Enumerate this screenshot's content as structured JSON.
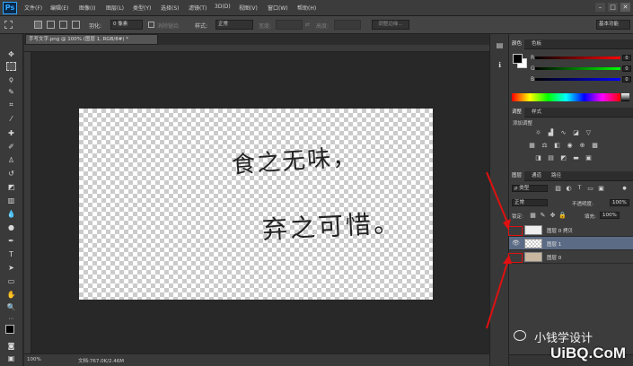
{
  "app": {
    "logo": "Ps"
  },
  "menu": [
    "文件(F)",
    "编辑(E)",
    "图像(I)",
    "图层(L)",
    "类型(Y)",
    "选择(S)",
    "滤镜(T)",
    "3D(D)",
    "视图(V)",
    "窗口(W)",
    "帮助(H)"
  ],
  "window_controls": {
    "minimize": "–",
    "maximize": "□",
    "close": "✕"
  },
  "options": {
    "feather_label": "羽化:",
    "feather_value": "0 像素",
    "antialias_label": "消除锯齿",
    "style_label": "样式:",
    "style_value": "正常",
    "width_label": "宽度:",
    "height_label": "高度:",
    "refine_label": "调整边缘...",
    "workspace": "基本功能"
  },
  "document": {
    "tab_title": "手写文字.png @ 100% (图层 1, RGB/8#) *",
    "zoom": "100%",
    "doc_info": "文档:767.0K/2.46M"
  },
  "color_panel": {
    "tabs": [
      "颜色",
      "色板"
    ],
    "channels": [
      {
        "label": "R",
        "value": "0"
      },
      {
        "label": "G",
        "value": "0"
      },
      {
        "label": "B",
        "value": "0"
      }
    ]
  },
  "adjustments_panel": {
    "tabs": [
      "调整",
      "样式"
    ],
    "title": "添加调整"
  },
  "layers_panel": {
    "tabs": [
      "图层",
      "通道",
      "路径"
    ],
    "filter": "ρ 类型",
    "blend_mode": "正常",
    "opacity_label": "不透明度:",
    "opacity": "100%",
    "lock_label": "锁定:",
    "fill_label": "填充:",
    "fill": "100%",
    "layers": [
      {
        "name": "图层 0 拷贝",
        "visible": false,
        "selected": false
      },
      {
        "name": "图层 1",
        "visible": true,
        "selected": true
      },
      {
        "name": "图层 0",
        "visible": false,
        "selected": false
      }
    ]
  },
  "canvas_text": {
    "line1": "食之无味，",
    "line2": "弃之可惜。"
  },
  "watermark": {
    "wechat": "小钱学设计",
    "site": "UiBQ.CoM"
  },
  "colors": {
    "accent": "#31a8ff",
    "selected_layer": "#5b6b85",
    "annotation": "#e01010"
  }
}
